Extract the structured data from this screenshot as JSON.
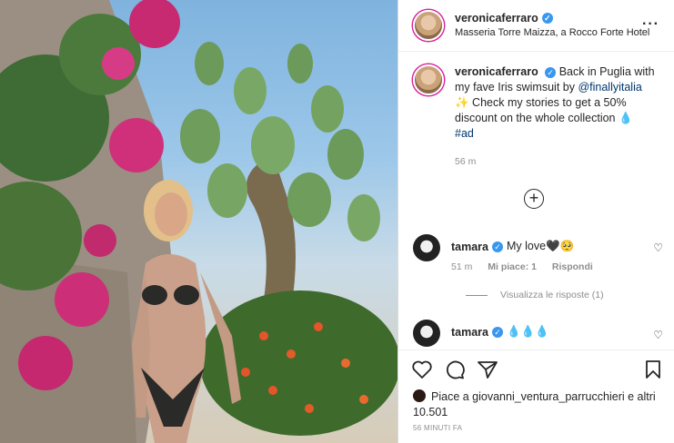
{
  "post": {
    "username": "veronicaferraro",
    "location": "Masseria Torre Maizza, a Rocco Forte Hotel",
    "more_icon": "more-icon"
  },
  "caption": {
    "username": "veronicaferraro",
    "text_1": "Back in Puglia with my fave Iris swimsuit by",
    "mention": "@finallyitalia",
    "text_2": "✨ Check my stories to get a 50% discount on the whole collection 💧",
    "hashtag": "#ad",
    "time": "56 m"
  },
  "comments": [
    {
      "username": "tamara",
      "text": "My love🖤🥺",
      "time": "51 m",
      "likes": "Mi piace: 1",
      "reply": "Rispondi",
      "view_replies": "Visualizza le risposte (1)"
    },
    {
      "username": "tamara",
      "text": "💧💧💧"
    }
  ],
  "likes": {
    "text": "Piace a giovanni_ventura_parrucchieri e altri 10.501"
  },
  "timestamp": "56 MINUTI FA",
  "colors": {
    "verified": "#3897f0",
    "link": "#00376b",
    "muted": "#8e8e8e"
  }
}
